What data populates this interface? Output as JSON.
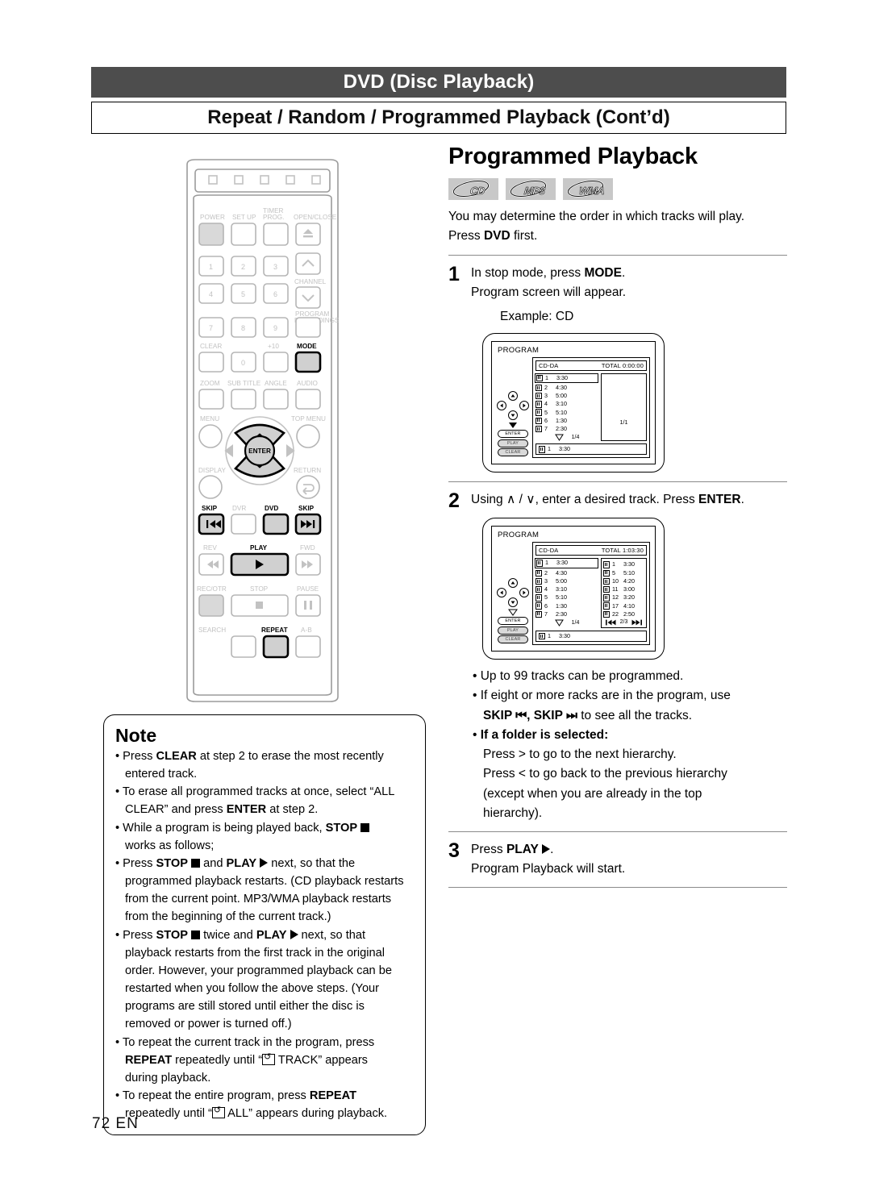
{
  "header": {
    "section": "DVD (Disc Playback)",
    "subsection": "Repeat / Random / Programmed Playback (Cont’d)"
  },
  "right": {
    "title": "Programmed Playback",
    "badges": [
      "CD",
      "MP3",
      "WMA"
    ],
    "lead_line1": "You may determine the order in which tracks will play.",
    "lead_line2_pre": "Press ",
    "lead_line2_bold": "DVD",
    "lead_line2_post": " first.",
    "steps": [
      {
        "num": "1",
        "line1_pre": "In stop mode, press ",
        "line1_bold": "MODE",
        "line1_post": ".",
        "line2": "Program screen will appear.",
        "example": "Example: CD"
      },
      {
        "num": "2",
        "line1_pre": "Using ",
        "line1_mid": ", enter a desired track.  Press ",
        "line1_bold": "ENTER",
        "line1_post": "."
      },
      {
        "num": "3",
        "line1_pre": "Press ",
        "line1_bold": "PLAY",
        "line1_post": ".",
        "line2": "Program Playback will start."
      }
    ],
    "bullets": [
      {
        "text": "Up to 99 tracks can be programmed."
      },
      {
        "text": "If eight or more racks are in the program, use"
      },
      {
        "cont": true,
        "bold_pre": "SKIP ",
        "bold_mid": ", SKIP ",
        "post": " to see all the tracks."
      },
      {
        "bold_all": "If a folder is selected:"
      },
      {
        "cont": true,
        "text": "Press > to go to the next hierarchy."
      },
      {
        "cont": true,
        "text": "Press < to go back to the previous hierarchy"
      },
      {
        "cont": true,
        "text": "(except when you are already in the top"
      },
      {
        "cont": true,
        "text": "hierarchy)."
      }
    ]
  },
  "program_screen_1": {
    "label": "PROGRAM",
    "disc_type": "CD-DA",
    "total_label": "TOTAL 0:00:00",
    "tracks": [
      {
        "no": "1",
        "time": "3:30",
        "selected": true
      },
      {
        "no": "2",
        "time": "4:30"
      },
      {
        "no": "3",
        "time": "5:00"
      },
      {
        "no": "4",
        "time": "3:10"
      },
      {
        "no": "5",
        "time": "5:10"
      },
      {
        "no": "6",
        "time": "1:30"
      },
      {
        "no": "7",
        "time": "2:30"
      }
    ],
    "page": "1/4",
    "right_page": "1/1",
    "programmed": [],
    "current": {
      "no": "1",
      "time": "3:30"
    },
    "dpad_labels": [
      "ENTER",
      "PLAY",
      "CLEAR"
    ]
  },
  "program_screen_2": {
    "label": "PROGRAM",
    "disc_type": "CD-DA",
    "total_label": "TOTAL 1:03:30",
    "tracks": [
      {
        "no": "1",
        "time": "3:30",
        "selected": true
      },
      {
        "no": "2",
        "time": "4:30"
      },
      {
        "no": "3",
        "time": "5:00"
      },
      {
        "no": "4",
        "time": "3:10"
      },
      {
        "no": "5",
        "time": "5:10"
      },
      {
        "no": "6",
        "time": "1:30"
      },
      {
        "no": "7",
        "time": "2:30"
      }
    ],
    "page": "1/4",
    "right_page": "2/3",
    "programmed": [
      {
        "no": "1",
        "time": "3:30"
      },
      {
        "no": "5",
        "time": "5:10"
      },
      {
        "no": "10",
        "time": "4:20"
      },
      {
        "no": "11",
        "time": "3:00"
      },
      {
        "no": "12",
        "time": "3:20"
      },
      {
        "no": "17",
        "time": "4:10"
      },
      {
        "no": "22",
        "time": "2:50"
      }
    ],
    "current": {
      "no": "1",
      "time": "3:30"
    },
    "dpad_labels": [
      "ENTER",
      "PLAY",
      "CLEAR"
    ]
  },
  "note": {
    "title": "Note",
    "items": [
      {
        "pre": "Press ",
        "bold": "CLEAR",
        "post": " at step 2 to erase the most recently"
      },
      {
        "cont": true,
        "text": "entered track."
      },
      {
        "text": "To erase all programmed tracks at once, select “ALL"
      },
      {
        "cont": true,
        "pre": "CLEAR” and press ",
        "bold": "ENTER",
        "post": " at step 2."
      },
      {
        "pre": "While a program is being played back, ",
        "bold": "STOP",
        "icon": "stop-square",
        "post": ""
      },
      {
        "cont": true,
        "text": "works as follows;"
      },
      {
        "pre": "Press ",
        "bold": "STOP",
        "icon": "stop-square",
        "mid": " and ",
        "bold2": "PLAY",
        "icon2": "play-triangle",
        "post": " next, so that the"
      },
      {
        "cont": true,
        "text": "programmed playback restarts. (CD playback restarts"
      },
      {
        "cont": true,
        "text": "from the current point. MP3/WMA playback restarts"
      },
      {
        "cont": true,
        "text": "from the beginning of the current track.)"
      },
      {
        "pre": "Press ",
        "bold": "STOP",
        "icon": "stop-square",
        "mid": " twice and ",
        "bold2": "PLAY",
        "icon2": "play-triangle",
        "post": " next, so that"
      },
      {
        "cont": true,
        "text": "playback restarts from the first track in the original"
      },
      {
        "cont": true,
        "text": "order. However, your programmed playback can be"
      },
      {
        "cont": true,
        "text": "restarted when you follow the above steps. (Your"
      },
      {
        "cont": true,
        "text": "programs are still stored until either the disc is"
      },
      {
        "cont": true,
        "text": "removed or power is turned off.)"
      },
      {
        "text": "To repeat the current track in the program, press"
      },
      {
        "cont": true,
        "bold": "REPEAT",
        "mid": " repeatedly until “",
        "icon3": "repeat-icon",
        "post": " TRACK” appears"
      },
      {
        "cont": true,
        "text": "during playback."
      },
      {
        "pre": "To repeat the entire program, press ",
        "bold": "REPEAT"
      },
      {
        "cont": true,
        "pre2": "repeatedly until “",
        "icon3": "repeat-icon",
        "post": " ALL” appears during playback."
      }
    ]
  },
  "remote": {
    "top_buttons": [
      "POWER",
      "SET UP",
      "TIMER PROG.",
      "OPEN/CLOSE"
    ],
    "numbers": [
      "1",
      "2",
      "3",
      "4",
      "5",
      "6",
      "7",
      "8",
      "9",
      "0"
    ],
    "channel_label": "CHANNEL",
    "program_recordings_label": "PROGRAM RECORDINGS",
    "clear_label": "CLEAR",
    "plus_ten_label": "+10",
    "mode_label": "MODE",
    "row_zoom": [
      "ZOOM",
      "SUB TITLE",
      "ANGLE",
      "AUDIO"
    ],
    "menu_label": "MENU",
    "top_menu_label": "TOP MENU",
    "enter_label": "ENTER",
    "display_label": "DISPLAY",
    "return_label": "RETURN",
    "skip_left_label": "SKIP",
    "dvr_label": "DVR",
    "dvd_label": "DVD",
    "skip_right_label": "SKIP",
    "rev_label": "REV",
    "play_label": "PLAY",
    "fwd_label": "FWD",
    "rec_otr_label": "REC/OTR",
    "stop_label": "STOP",
    "pause_label": "PAUSE",
    "search_label": "SEARCH",
    "repeat_label": "REPEAT",
    "ab_label": "A-B",
    "highlighted": [
      "MODE",
      "DVD",
      "PLAY",
      "REPEAT",
      "SKIP-left",
      "SKIP-right"
    ]
  },
  "footer": {
    "page": "72  EN"
  },
  "colors": {
    "header_bg": "#4d4d4d",
    "badge_bg": "#c8c8c8",
    "remote_gray": "#d9d9d9",
    "rule": "#8a8a8a"
  }
}
